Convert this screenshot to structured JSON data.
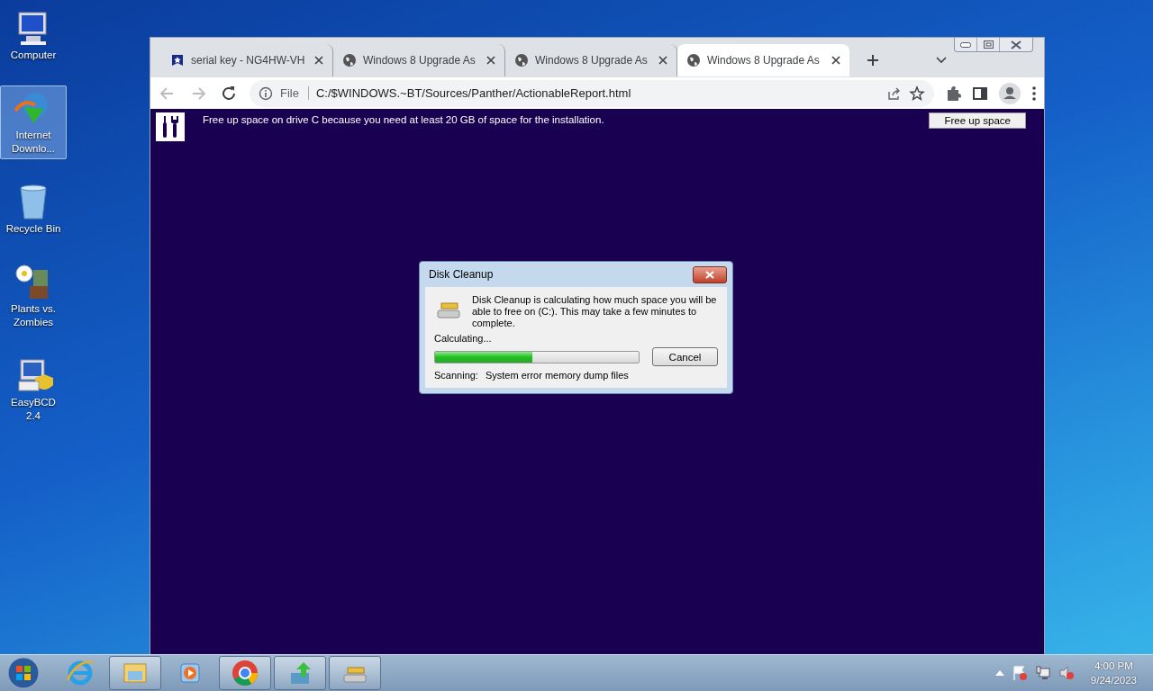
{
  "desktop_icons": [
    {
      "label": "Computer",
      "kind": "computer",
      "selected": false
    },
    {
      "label": "Internet Downlo...",
      "kind": "downloader",
      "selected": true
    },
    {
      "label": "Recycle Bin",
      "kind": "bin",
      "selected": false
    },
    {
      "label": "Plants vs. Zombies",
      "kind": "game",
      "selected": false
    },
    {
      "label": "EasyBCD 2.4",
      "kind": "bcd",
      "selected": false
    }
  ],
  "browser": {
    "tabs": [
      {
        "title": "serial key - NG4HW-VH",
        "kind": "shield",
        "selected": false
      },
      {
        "title": "Windows 8 Upgrade As",
        "kind": "globe",
        "selected": false
      },
      {
        "title": "Windows 8 Upgrade As",
        "kind": "globe",
        "selected": false
      },
      {
        "title": "Windows 8 Upgrade As",
        "kind": "globe",
        "selected": true
      }
    ],
    "address": {
      "scheme": "File",
      "url": "C:/$WINDOWS.~BT/Sources/Panther/ActionableReport.html"
    },
    "banner": {
      "message": "Free up space on drive C because you need at least 20 GB of space for the installation.",
      "button": "Free up space"
    }
  },
  "dialog": {
    "title": "Disk Cleanup",
    "message": "Disk Cleanup is calculating how much space you will be able to free on  (C:). This may take a few minutes to complete.",
    "status": "Calculating...",
    "level": 0.48,
    "cancel": "Cancel",
    "scanning_label": "Scanning:",
    "scanning_item": "System error memory dump files"
  },
  "taskbar": {
    "items": [
      {
        "kind": "ie",
        "running": false
      },
      {
        "kind": "explorer",
        "running": true
      },
      {
        "kind": "media",
        "running": false
      },
      {
        "kind": "chrome",
        "running": true
      },
      {
        "kind": "download",
        "running": true
      },
      {
        "kind": "cleanup",
        "running": true
      }
    ],
    "time": "4:00 PM",
    "date": "9/24/2023"
  }
}
